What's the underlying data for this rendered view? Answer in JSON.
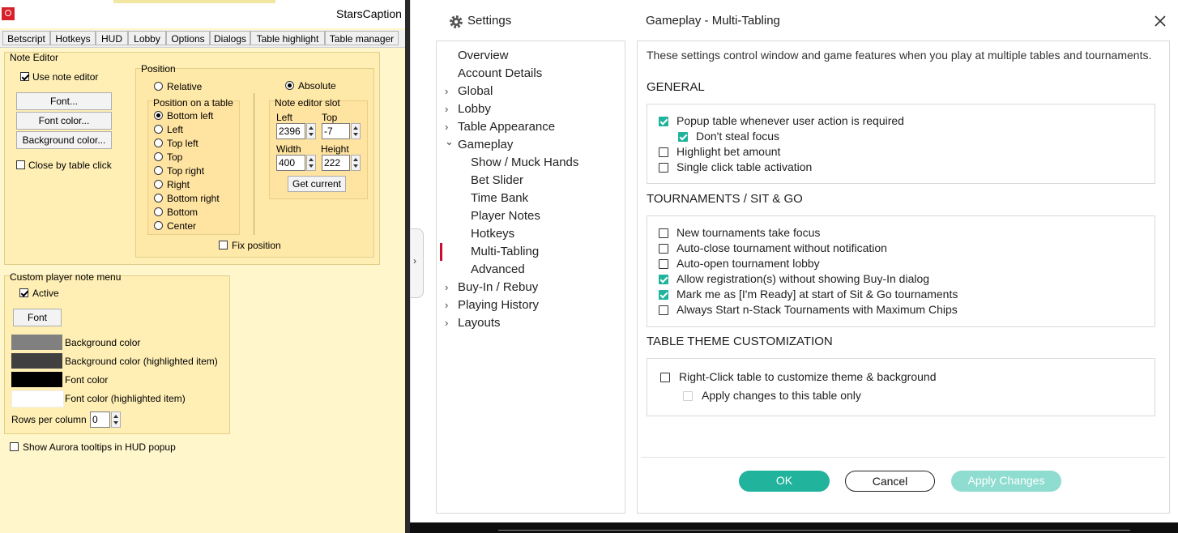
{
  "starscaption": {
    "title": "StarsCaption",
    "tabs": [
      "Betscript",
      "Hotkeys",
      "HUD",
      "Lobby",
      "Options",
      "Dialogs",
      "Table highlight",
      "Table manager"
    ],
    "note_editor": {
      "group_label": "Note Editor",
      "use_note_editor": "Use note editor",
      "font_button": "Font...",
      "font_color_button": "Font color...",
      "background_color_button": "Background color...",
      "close_by_table_click": "Close by table click",
      "position": {
        "group_label": "Position",
        "relative": "Relative",
        "absolute": "Absolute",
        "on_table_label": "Position on a table",
        "options": [
          "Bottom left",
          "Left",
          "Top left",
          "Top",
          "Top right",
          "Right",
          "Bottom right",
          "Bottom",
          "Center"
        ],
        "selected": "Bottom left",
        "slot_label": "Note editor slot",
        "left_label": "Left",
        "top_label": "Top",
        "width_label": "Width",
        "height_label": "Height",
        "left_value": "2396",
        "top_value": "-7",
        "width_value": "400",
        "height_value": "222",
        "get_current": "Get current",
        "fix_position": "Fix position"
      }
    },
    "custom_menu": {
      "group_label": "Custom player note menu",
      "active": "Active",
      "font_button": "Font",
      "colors": [
        {
          "label": "Background color",
          "color": "#808080"
        },
        {
          "label": "Background color (highlighted item)",
          "color": "#404040"
        },
        {
          "label": "Font color",
          "color": "#000000"
        },
        {
          "label": "Font color (highlighted item)",
          "color": "#ffffff"
        }
      ],
      "rows_per_column_label": "Rows per column",
      "rows_per_column_value": "0"
    },
    "aurora_tooltips": "Show Aurora tooltips in HUD popup"
  },
  "settings": {
    "title": "Settings",
    "page_title": "Gameplay - Multi-Tabling",
    "nav": [
      {
        "label": "Overview",
        "level": 0,
        "chevron": ""
      },
      {
        "label": "Account Details",
        "level": 0,
        "chevron": ""
      },
      {
        "label": "Global",
        "level": 0,
        "chevron": "›"
      },
      {
        "label": "Lobby",
        "level": 0,
        "chevron": "›"
      },
      {
        "label": "Table Appearance",
        "level": 0,
        "chevron": "›"
      },
      {
        "label": "Gameplay",
        "level": 0,
        "chevron": "⌄"
      },
      {
        "label": "Show / Muck Hands",
        "level": 1,
        "chevron": ""
      },
      {
        "label": "Bet Slider",
        "level": 1,
        "chevron": ""
      },
      {
        "label": "Time Bank",
        "level": 1,
        "chevron": ""
      },
      {
        "label": "Player Notes",
        "level": 1,
        "chevron": ""
      },
      {
        "label": "Hotkeys",
        "level": 1,
        "chevron": ""
      },
      {
        "label": "Multi-Tabling",
        "level": 1,
        "chevron": "",
        "active": true
      },
      {
        "label": "Advanced",
        "level": 1,
        "chevron": ""
      },
      {
        "label": "Buy-In / Rebuy",
        "level": 0,
        "chevron": "›"
      },
      {
        "label": "Playing History",
        "level": 0,
        "chevron": "›"
      },
      {
        "label": "Layouts",
        "level": 0,
        "chevron": "›"
      }
    ],
    "intro": "These settings control window and game features when you play at multiple tables and tournaments.",
    "general": {
      "heading": "GENERAL",
      "items": [
        {
          "label": "Popup table whenever user action is required",
          "checked": true,
          "indent": false
        },
        {
          "label": "Don't steal focus",
          "checked": true,
          "indent": true
        },
        {
          "label": "Highlight bet amount",
          "checked": false,
          "indent": false
        },
        {
          "label": "Single click table activation",
          "checked": false,
          "indent": false
        }
      ]
    },
    "tournaments": {
      "heading": "TOURNAMENTS / SIT & GO",
      "items": [
        {
          "label": "New tournaments take focus",
          "checked": false
        },
        {
          "label": "Auto-close tournament without notification",
          "checked": false
        },
        {
          "label": "Auto-open tournament lobby",
          "checked": false
        },
        {
          "label": "Allow registration(s) without showing Buy-In dialog",
          "checked": true
        },
        {
          "label": "Mark me as [I'm Ready] at start of Sit & Go tournaments",
          "checked": true
        },
        {
          "label": "Always Start n-Stack Tournaments with Maximum Chips",
          "checked": false
        }
      ]
    },
    "theme": {
      "heading": "TABLE THEME CUSTOMIZATION",
      "right_click": "Right-Click table to customize theme & background",
      "apply_this_table": "Apply changes to this table only"
    },
    "buttons": {
      "ok": "OK",
      "cancel": "Cancel",
      "apply": "Apply Changes"
    },
    "colors": {
      "accent": "#21b39c",
      "active_marker": "#c8102e"
    }
  }
}
